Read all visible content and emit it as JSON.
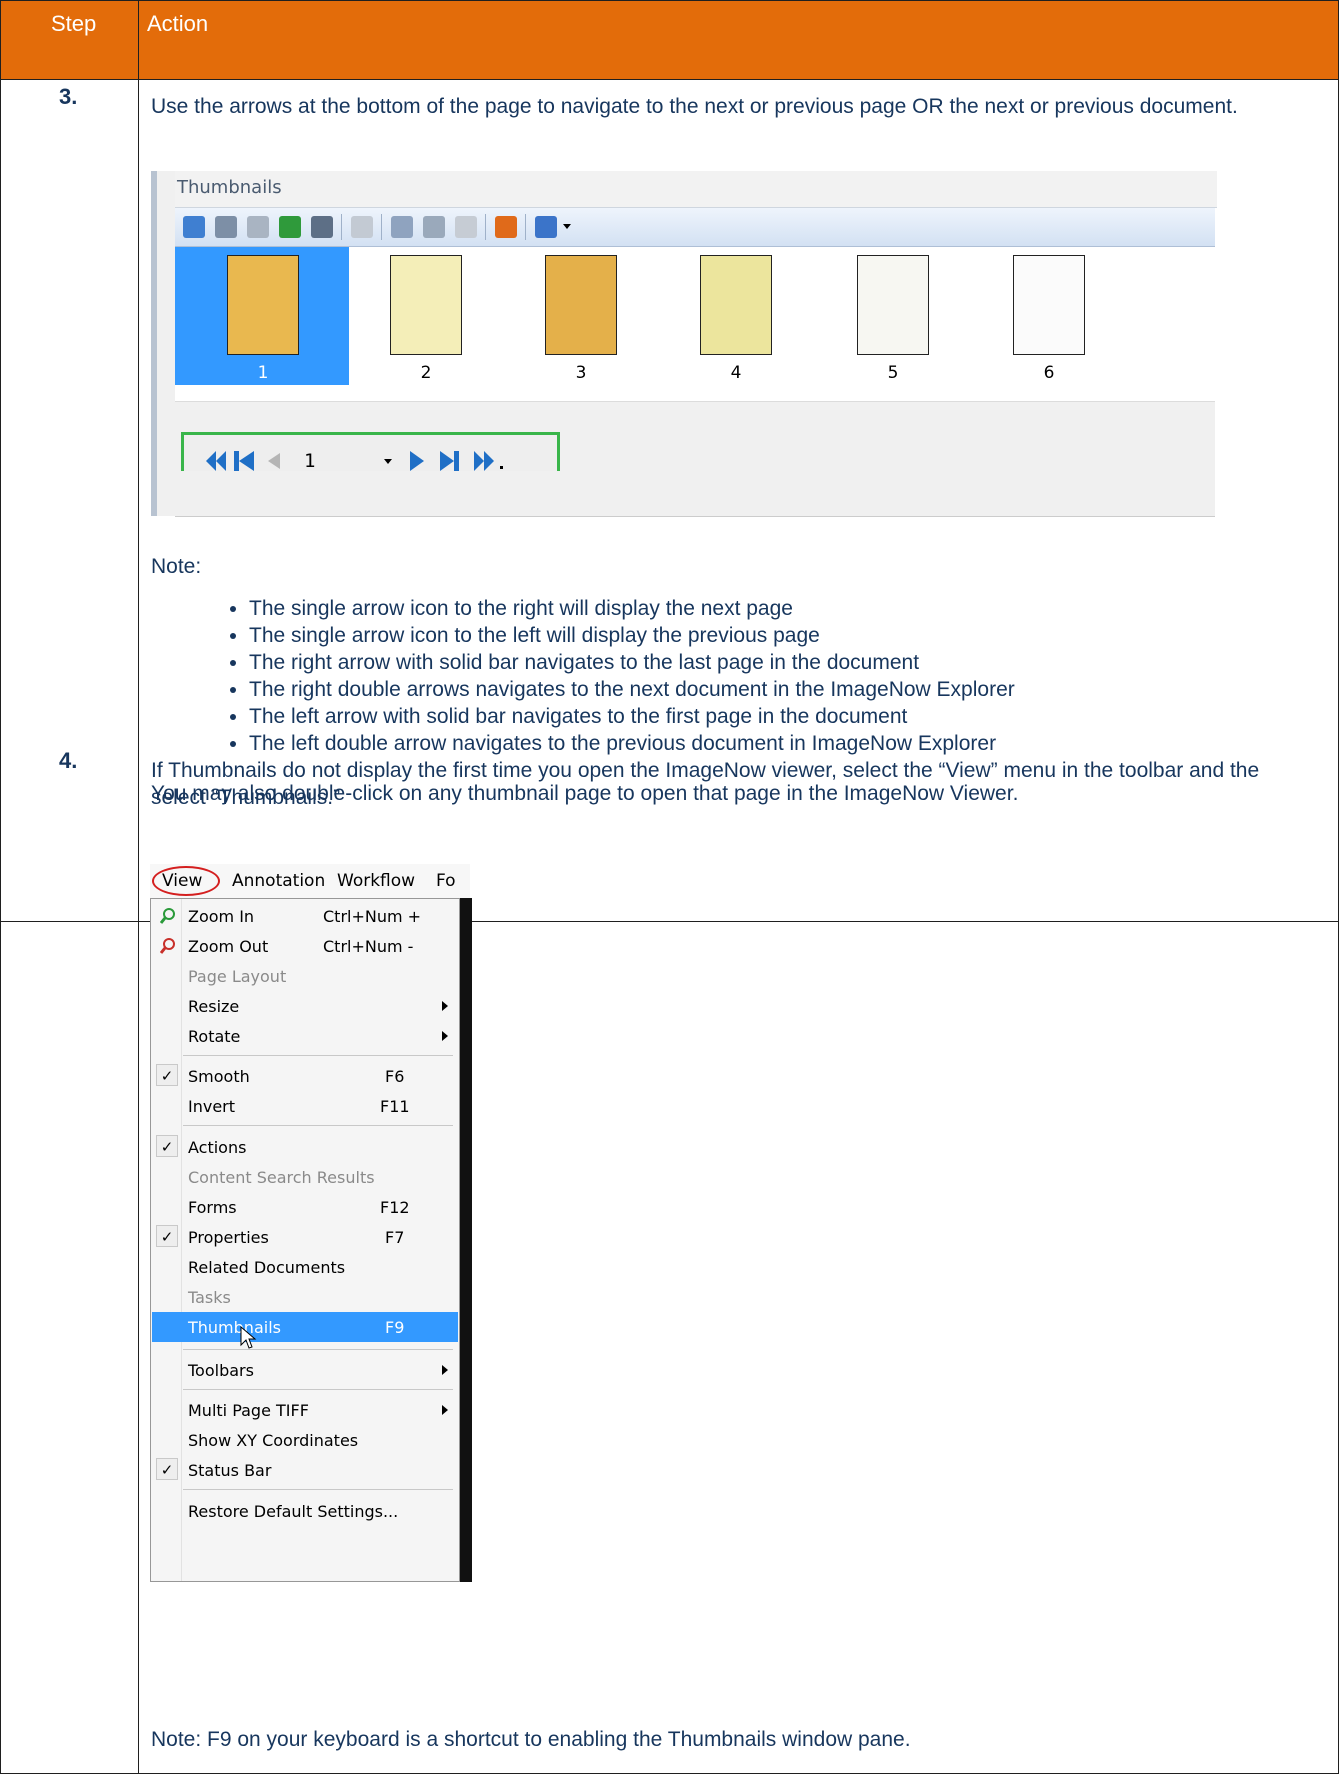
{
  "table": {
    "header": {
      "step": "Step",
      "action": "Action"
    },
    "row3": {
      "step": "3.",
      "intro": "Use the arrows at the bottom of the page to navigate to the next or previous page OR the next or previous document.",
      "note_label": "Note:",
      "notes": [
        "The single arrow icon to the right will display the next page",
        "The single arrow icon to the left will display the previous page",
        "The right arrow with solid bar navigates to the last page in the document",
        "The right double arrows navigates to the next document in the ImageNow Explorer",
        "The left arrow with solid bar navigates to the first page in the document",
        "The left double arrow navigates to the previous document in ImageNow Explorer"
      ],
      "outro": "You may also double-click on any thumbnail page to open that page in the ImageNow Viewer."
    },
    "row4": {
      "step": "4.",
      "intro": "If Thumbnails do not display the first time you open the ImageNow viewer, select the “View” menu in the toolbar and the select “Thumbnails.”",
      "note": "Note:  F9 on your keyboard is a shortcut to enabling the Thumbnails window pane."
    }
  },
  "thumbnails_panel": {
    "title": "Thumbnails",
    "pages": [
      "1",
      "2",
      "3",
      "4",
      "5",
      "6"
    ],
    "selected_page": "1",
    "nav_page_value": "1",
    "toolbar_icons": [
      "open-folder-icon",
      "scan-icon",
      "capture-icon",
      "upload-icon",
      "print-icon",
      "page-icon",
      "cut-icon",
      "copy-icon",
      "paste-icon",
      "delete-icon",
      "zoom-icon"
    ],
    "nav_icons": [
      "previous-document-icon",
      "first-page-icon",
      "previous-page-icon",
      "next-page-icon",
      "last-page-icon",
      "next-document-icon"
    ],
    "colors": {
      "selection": "#3399ff",
      "highlight_box": "#39b54a",
      "nav_arrows": "#1f6fc6"
    }
  },
  "view_menu": {
    "menubar": [
      "View",
      "Annotation",
      "Workflow",
      "Fo"
    ],
    "items": [
      {
        "label": "Zoom In",
        "shortcut": "Ctrl+Num +",
        "icon": "zoom-in-icon"
      },
      {
        "label": "Zoom Out",
        "shortcut": "Ctrl+Num -",
        "icon": "zoom-out-icon"
      },
      {
        "label": "Page Layout",
        "disabled": true
      },
      {
        "label": "Resize",
        "submenu": true
      },
      {
        "label": "Rotate",
        "submenu": true
      },
      {
        "label": "Smooth",
        "shortcut": "F6",
        "checked": true
      },
      {
        "label": "Invert",
        "shortcut": "F11"
      },
      {
        "label": "Actions",
        "checked": true
      },
      {
        "label": "Content Search Results",
        "disabled": true
      },
      {
        "label": "Forms",
        "shortcut": "F12"
      },
      {
        "label": "Properties",
        "shortcut": "F7",
        "checked": true
      },
      {
        "label": "Related Documents"
      },
      {
        "label": "Tasks",
        "disabled": true
      },
      {
        "label": "Thumbnails",
        "shortcut": "F9",
        "highlighted": true
      },
      {
        "label": "Toolbars",
        "submenu": true
      },
      {
        "label": "Multi Page TIFF",
        "submenu": true
      },
      {
        "label": "Show XY Coordinates"
      },
      {
        "label": "Status Bar",
        "checked": true
      },
      {
        "label": "Restore Default Settings..."
      }
    ],
    "check_glyph": "✓"
  }
}
